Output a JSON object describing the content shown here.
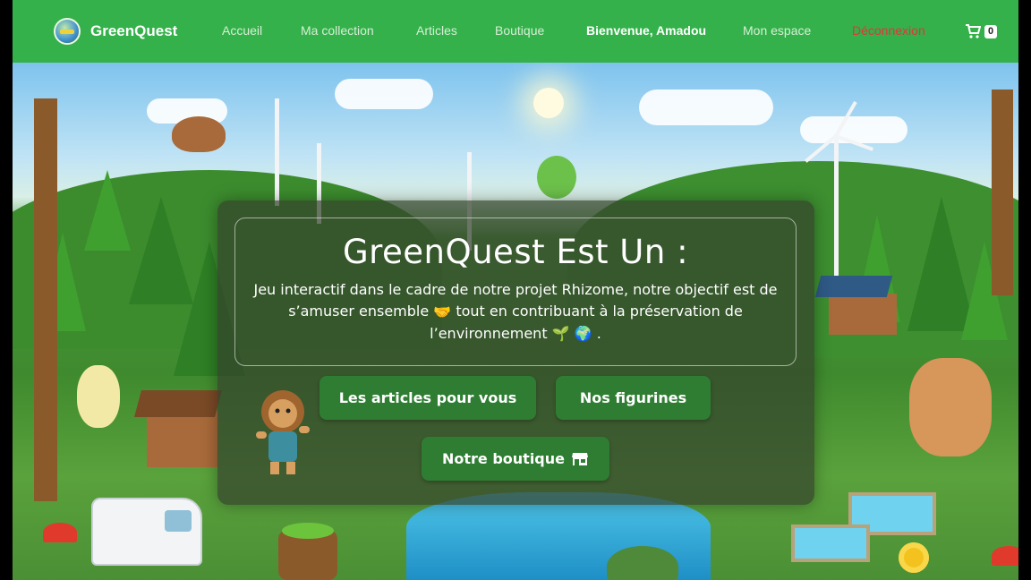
{
  "brand": {
    "name": "GreenQuest",
    "logo_icon": "greenquest-globe-logo"
  },
  "nav": {
    "items": [
      {
        "label": "Accueil"
      },
      {
        "label": "Ma collection"
      },
      {
        "label": "Articles"
      },
      {
        "label": "Boutique"
      }
    ],
    "welcome": "Bienvenue, Amadou",
    "account": "Mon espace",
    "logout": "Déconnexion",
    "cart_count": "0",
    "cart_icon": "shopping-cart-icon"
  },
  "hero": {
    "title": "GreenQuest Est Un :",
    "text_line": "Jeu interactif dans le cadre de notre projet Rhizome, notre objectif est de s’amuser ensemble",
    "text_mid": "tout en contribuant à la préservation de l’environnement",
    "text_end": ".",
    "emoji_handshake": "🤝",
    "emoji_seedling": "🌱",
    "emoji_globe": "🌍"
  },
  "buttons": {
    "articles": "Les articles pour vous",
    "figurines": "Nos figurines",
    "shop": "Notre boutique",
    "shop_icon": "store-icon"
  },
  "colors": {
    "navbar": "#34b14a",
    "button": "#2e7d32",
    "logout": "#e0373a",
    "overlay": "rgba(52,66,44,0.72)"
  }
}
